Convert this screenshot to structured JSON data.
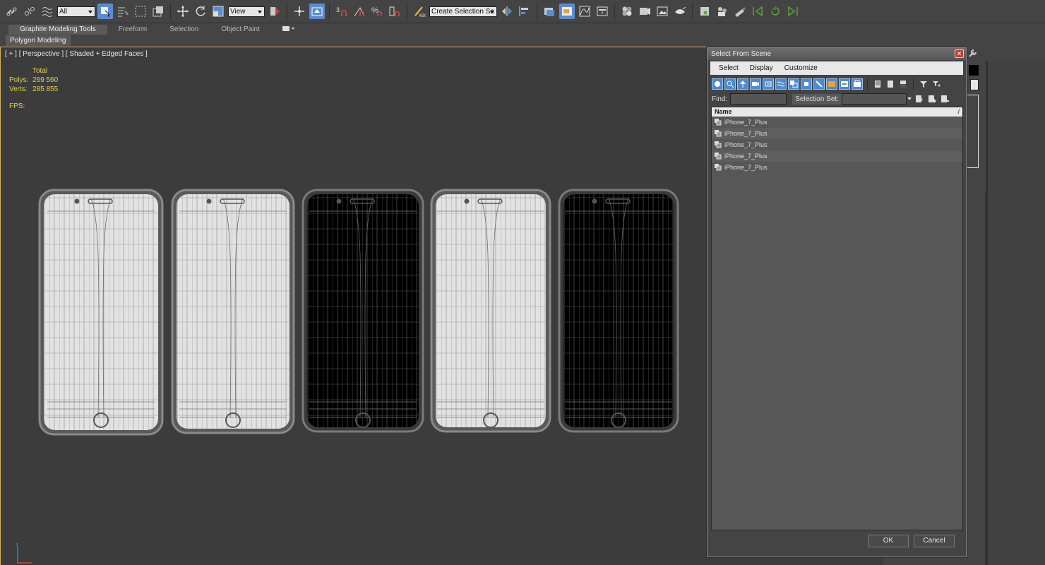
{
  "toolbar": {
    "filter_value": "All",
    "coord_system": "View",
    "snap_label": "3",
    "selection_set_placeholder": "Create Selection Se"
  },
  "ribbon": {
    "tabs": [
      {
        "label": "Graphite Modeling Tools",
        "active": true
      },
      {
        "label": "Freeform",
        "active": false
      },
      {
        "label": "Selection",
        "active": false
      },
      {
        "label": "Object Paint",
        "active": false
      }
    ],
    "panel_label": "Polygon Modeling"
  },
  "viewport": {
    "label": "[ + ] [ Perspective ] [ Shaded + Edged Faces ]",
    "stats_header": "Total",
    "polys_label": "Polys:",
    "polys_value": "269 560",
    "verts_label": "Verts:",
    "verts_value": "285 855",
    "fps_label": "FPS:"
  },
  "dialog": {
    "title": "Select From Scene",
    "close": "✕",
    "menu": [
      "Select",
      "Display",
      "Customize"
    ],
    "find_label": "Find:",
    "find_value": "",
    "selection_set_label": "Selection Set:",
    "list_header": "Name",
    "sort_indicator": "/",
    "items": [
      "iPhone_7_Plus",
      "iPhone_7_Plus",
      "iPhone_7_Plus",
      "iPhone_7_Plus",
      "iPhone_7_Plus"
    ],
    "ok_label": "OK",
    "cancel_label": "Cancel"
  },
  "colors": {
    "accent_blue": "#4b8bd4",
    "stats_yellow": "#e7d24d",
    "viewport_bg": "#3c3c3c",
    "active_border": "#d8b052"
  }
}
